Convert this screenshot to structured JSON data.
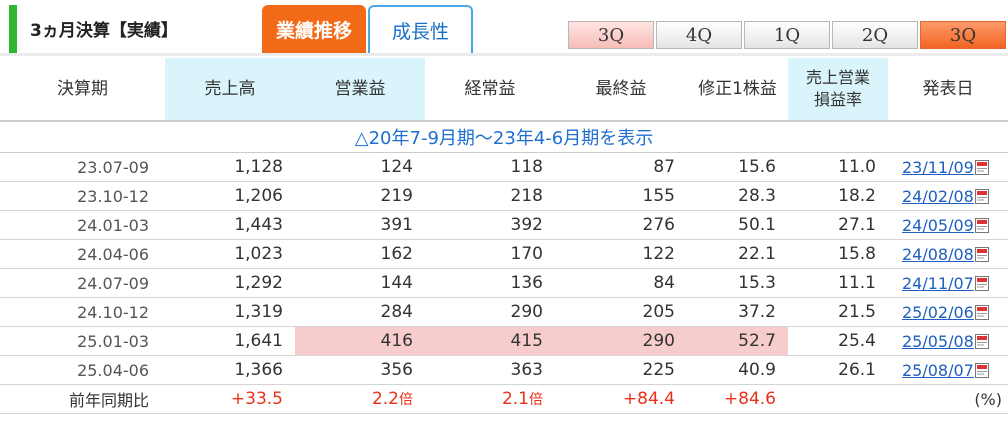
{
  "header": {
    "title": "3ヵ月決算【実績】",
    "tab_active": "業績推移",
    "tab_inactive": "成長性",
    "quarter_buttons": [
      "3Q",
      "4Q",
      "1Q",
      "2Q",
      "3Q"
    ],
    "selected_quarter_index": 4,
    "colors": {
      "accent": "#f26a17",
      "green_bar": "#2fb82f",
      "link": "#1f5fbf",
      "positive": "#e8311a",
      "highlight": "#f6cccc"
    }
  },
  "table": {
    "columns": [
      "決算期",
      "売上高",
      "営業益",
      "経常益",
      "最終益",
      "修正1株益",
      "売上営業\n損益率",
      "発表日"
    ],
    "period_label": "△20年7-9月期～23年4-6月期を表示",
    "rows": [
      {
        "period": "23.07-09",
        "sales": "1,128",
        "op": "124",
        "ord": "118",
        "net": "87",
        "eps": "15.6",
        "margin": "11.0",
        "date": "23/11/09"
      },
      {
        "period": "23.10-12",
        "sales": "1,206",
        "op": "219",
        "ord": "218",
        "net": "155",
        "eps": "28.3",
        "margin": "18.2",
        "date": "24/02/08"
      },
      {
        "period": "24.01-03",
        "sales": "1,443",
        "op": "391",
        "ord": "392",
        "net": "276",
        "eps": "50.1",
        "margin": "27.1",
        "date": "24/05/09"
      },
      {
        "period": "24.04-06",
        "sales": "1,023",
        "op": "162",
        "ord": "170",
        "net": "122",
        "eps": "22.1",
        "margin": "15.8",
        "date": "24/08/08"
      },
      {
        "period": "24.07-09",
        "sales": "1,292",
        "op": "144",
        "ord": "136",
        "net": "84",
        "eps": "15.3",
        "margin": "11.1",
        "date": "24/11/07"
      },
      {
        "period": "24.10-12",
        "sales": "1,319",
        "op": "284",
        "ord": "290",
        "net": "205",
        "eps": "37.2",
        "margin": "21.5",
        "date": "25/02/06"
      },
      {
        "period": "25.01-03",
        "sales": "1,641",
        "op": "416",
        "ord": "415",
        "net": "290",
        "eps": "52.7",
        "margin": "25.4",
        "date": "25/05/08"
      },
      {
        "period": "25.04-06",
        "sales": "1,366",
        "op": "356",
        "ord": "363",
        "net": "225",
        "eps": "40.9",
        "margin": "26.1",
        "date": "25/08/07"
      }
    ],
    "highlight_row_index": 6,
    "yoy": {
      "label": "前年同期比",
      "sales": "+33.5",
      "op": "2.2",
      "op_unit": "倍",
      "ord": "2.1",
      "ord_unit": "倍",
      "net": "+84.4",
      "eps": "+84.6",
      "unit": "(%)"
    },
    "pdf_icon": "pdf-icon"
  }
}
